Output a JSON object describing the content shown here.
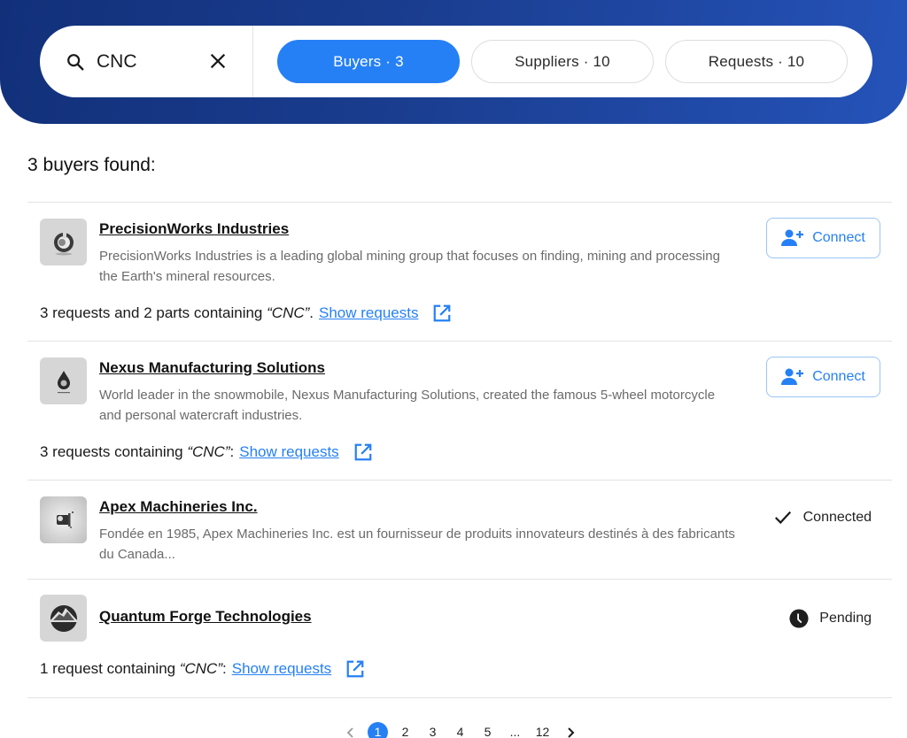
{
  "search": {
    "value": "CNC",
    "icon": "search-icon",
    "clear_icon": "close-icon"
  },
  "tabs": [
    {
      "label": "Buyers · 3",
      "active": true
    },
    {
      "label": "Suppliers · 10",
      "active": false
    },
    {
      "label": "Requests · 10",
      "active": false
    }
  ],
  "results_title": "3 buyers found:",
  "colors": {
    "accent": "#2680f5",
    "hero_start": "#12307a",
    "hero_end": "#2553b9"
  },
  "items": [
    {
      "name": "PrecisionWorks Industries",
      "description": "PrecisionWorks Industries is a leading global mining group that focuses on finding, mining and processing the Earth's mineral resources.",
      "req_prefix": "3 requests and 2 parts containing ",
      "req_term": "“CNC”",
      "req_suffix": ".",
      "link": "Show requests",
      "action": "Connect"
    },
    {
      "name": "Nexus Manufacturing Solutions",
      "description": "World leader in the snowmobile, Nexus Manufacturing Solutions, created the famous 5-wheel motorcycle and personal watercraft industries.",
      "req_prefix": "3 requests containing ",
      "req_term": "“CNC”",
      "req_suffix": ":",
      "link": "Show requests",
      "action": "Connect"
    },
    {
      "name": "Apex Machineries Inc.",
      "description": "Fondée en 1985, Apex Machineries Inc. est un fournisseur de produits innovateurs destinés à des fabricants du Canada...",
      "status": "Connected",
      "status_icon": "check-icon"
    },
    {
      "name": "Quantum Forge Technologies",
      "req_prefix": "1 request containing ",
      "req_term": "“CNC”",
      "req_suffix": ":",
      "link": "Show requests",
      "status": "Pending",
      "status_icon": "clock-icon"
    }
  ],
  "pagination": {
    "pages": [
      "1",
      "2",
      "3",
      "4",
      "5",
      "...",
      "12"
    ],
    "current": "1"
  }
}
